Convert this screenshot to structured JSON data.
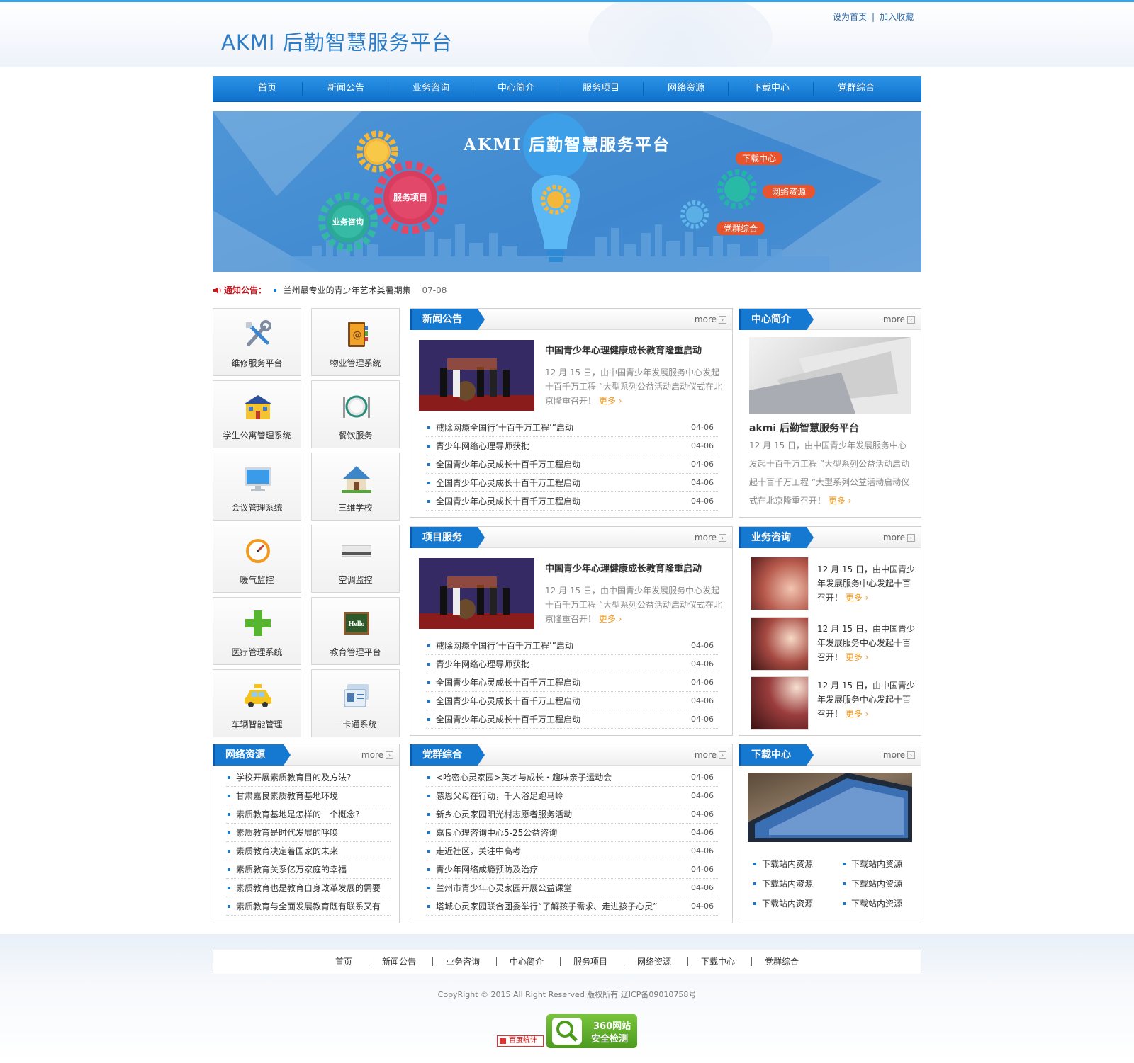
{
  "header": {
    "site_title": "AKMI 后勤智慧服务平台",
    "set_home": "设为首页",
    "separator": "|",
    "add_favorite": "加入收藏"
  },
  "nav": [
    "首页",
    "新闻公告",
    "业务咨询",
    "中心简介",
    "服务项目",
    "网络资源",
    "下载中心",
    "党群综合"
  ],
  "banner": {
    "title": "AKMI 后勤智慧服务平台",
    "gear_service": "服务项目",
    "gear_consult": "业务咨询",
    "tag_download": "下载中心",
    "tag_network": "网络资源",
    "tag_party": "党群综合"
  },
  "notice": {
    "label": "通知公告：",
    "text": "兰州最专业的青少年艺术类暑期集",
    "date": "07-08"
  },
  "systems": [
    {
      "label": "维修服务平台",
      "icon": "tools-icon"
    },
    {
      "label": "物业管理系统",
      "icon": "address-book-icon"
    },
    {
      "label": "学生公寓管理系统",
      "icon": "apartment-icon"
    },
    {
      "label": "餐饮服务",
      "icon": "dining-icon"
    },
    {
      "label": "会议管理系统",
      "icon": "monitor-icon"
    },
    {
      "label": "三维学校",
      "icon": "house-icon"
    },
    {
      "label": "暖气监控",
      "icon": "gauge-icon"
    },
    {
      "label": "空调监控",
      "icon": "air-conditioner-icon"
    },
    {
      "label": "医疗管理系统",
      "icon": "medical-cross-icon"
    },
    {
      "label": "教育管理平台",
      "icon": "chalkboard-icon"
    },
    {
      "label": "车辆智能管理",
      "icon": "taxi-icon"
    },
    {
      "label": "一卡通系统",
      "icon": "id-card-icon"
    }
  ],
  "more_label": "more",
  "more_link": "更多",
  "news": {
    "title": "新闻公告",
    "headline": "中国青少年心理健康成长教育隆重启动",
    "summary": "12 月 15 日，由中国青少年发展服务中心发起十百千万工程 ”大型系列公益活动启动仪式在北京隆重召开！",
    "items": [
      {
        "text": "戒除网瘾全国行‘十百千万工程’”启动",
        "date": "04-06"
      },
      {
        "text": "青少年网络心理导师获批",
        "date": "04-06"
      },
      {
        "text": "全国青少年心灵成长十百千万工程启动",
        "date": "04-06"
      },
      {
        "text": "全国青少年心灵成长十百千万工程启动",
        "date": "04-06"
      },
      {
        "text": "全国青少年心灵成长十百千万工程启动",
        "date": "04-06"
      }
    ]
  },
  "intro": {
    "title": "中心简介",
    "heading": "akmi 后勤智慧服务平台",
    "text": "12 月 15 日，由中国青少年发展服务中心发起十百千万工程 ”大型系列公益活动启动起十百千万工程 ”大型系列公益活动启动仪式在北京隆重召开！"
  },
  "projects": {
    "title": "项目服务",
    "headline": "中国青少年心理健康成长教育隆重启动",
    "summary": "12 月 15 日，由中国青少年发展服务中心发起十百千万工程 ”大型系列公益活动启动仪式在北京隆重召开！",
    "items": [
      {
        "text": "戒除网瘾全国行‘十百千万工程’”启动",
        "date": "04-06"
      },
      {
        "text": "青少年网络心理导师获批",
        "date": "04-06"
      },
      {
        "text": "全国青少年心灵成长十百千万工程启动",
        "date": "04-06"
      },
      {
        "text": "全国青少年心灵成长十百千万工程启动",
        "date": "04-06"
      },
      {
        "text": "全国青少年心灵成长十百千万工程启动",
        "date": "04-06"
      }
    ]
  },
  "consult": {
    "title": "业务咨询",
    "items": [
      {
        "text": "12 月 15 日，由中国青少年发展服务中心发起十百召开！"
      },
      {
        "text": "12 月 15 日，由中国青少年发展服务中心发起十百召开！"
      },
      {
        "text": "12 月 15 日，由中国青少年发展服务中心发起十百召开！"
      }
    ]
  },
  "network": {
    "title": "网络资源",
    "items": [
      "学校开展素质教育目的及方法?",
      "甘肃嘉良素质教育基地环境",
      "素质教育基地是怎样的一个概念?",
      "素质教育是时代发展的呼唤",
      "素质教育决定着国家的未来",
      "素质教育关系亿万家庭的幸福",
      "素质教育也是教育自身改革发展的需要",
      "素质教育与全面发展教育既有联系又有"
    ]
  },
  "party": {
    "title": "党群综合",
    "items": [
      {
        "text": "<哈密心灵家园>英才与成长・趣味亲子运动会",
        "date": "04-06"
      },
      {
        "text": "感恩父母在行动，千人浴足跑马岭",
        "date": "04-06"
      },
      {
        "text": "新乡心灵家园阳光村志愿者服务活动",
        "date": "04-06"
      },
      {
        "text": "嘉良心理咨询中心5-25公益咨询",
        "date": "04-06"
      },
      {
        "text": "走近社区，关注中高考",
        "date": "04-06"
      },
      {
        "text": "青少年网络成瘾预防及治疗",
        "date": "04-06"
      },
      {
        "text": "兰州市青少年心灵家园开展公益课堂",
        "date": "04-06"
      },
      {
        "text": "塔城心灵家园联合团委举行“了解孩子需求、走进孩子心灵”",
        "date": "04-06"
      }
    ]
  },
  "download": {
    "title": "下载中心",
    "items": [
      "下载站内资源",
      "下载站内资源",
      "下载站内资源",
      "下载站内资源",
      "下载站内资源",
      "下载站内资源"
    ]
  },
  "footer": {
    "nav": [
      "首页",
      "新闻公告",
      "业务咨询",
      "中心简介",
      "服务项目",
      "网络资源",
      "下载中心",
      "党群综合"
    ],
    "sep": "|",
    "copyright": "CopyRight © 2015 All Right Reserved 版权所有 辽ICP备09010758号",
    "baidu": "百度统计",
    "badge_line1": "360网站",
    "badge_line2": "安全检测"
  },
  "colors": {
    "brand_blue": "#1579d2",
    "nav_blue": "#0f70cc",
    "notice_red": "#c9151e",
    "more_orange": "#f39a1c"
  }
}
